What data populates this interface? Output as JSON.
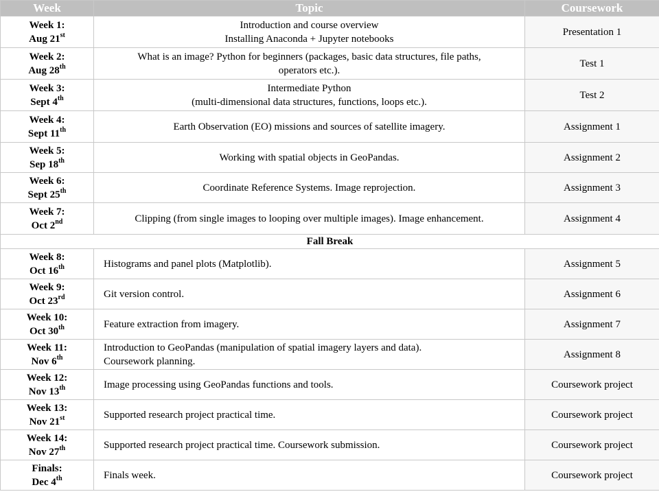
{
  "header": {
    "week": "Week",
    "topic": "Topic",
    "coursework": "Coursework"
  },
  "break_label": "Fall Break",
  "rows_before_break": [
    {
      "week": "Week 1:",
      "date": "Aug 21",
      "suffix": "st",
      "topic": [
        "Introduction and course overview",
        "Installing Anaconda + Jupyter notebooks"
      ],
      "coursework": "Presentation 1",
      "align": "center",
      "h": 46
    },
    {
      "week": "Week 2:",
      "date": "Aug 28",
      "suffix": "th",
      "topic": [
        "What is an image? Python for beginners (packages, basic data structures, file paths,",
        "operators etc.)."
      ],
      "coursework": "Test 1",
      "align": "center",
      "h": 46
    },
    {
      "week": "Week 3:",
      "date": "Sept 4",
      "suffix": "th",
      "topic": [
        "Intermediate Python",
        "(multi-dimensional data structures, functions, loops etc.)."
      ],
      "coursework": "Test 2",
      "align": "center",
      "h": 46
    },
    {
      "week": "Week 4:",
      "date": "Sept 11",
      "suffix": "th",
      "topic": [
        "Earth Observation (EO) missions and sources of satellite imagery."
      ],
      "coursework": "Assignment 1",
      "align": "center",
      "h": 46
    },
    {
      "week": "Week 5:",
      "date": "Sep 18",
      "suffix": "th",
      "topic": [
        "Working with spatial objects in GeoPandas."
      ],
      "coursework": "Assignment 2",
      "align": "center",
      "h": 44
    },
    {
      "week": "Week 6:",
      "date": "Sept 25",
      "suffix": "th",
      "topic": [
        "Coordinate Reference Systems. Image reprojection."
      ],
      "coursework": "Assignment 3",
      "align": "center",
      "h": 44
    },
    {
      "week": "Week 7:",
      "date": "Oct 2",
      "suffix": "nd",
      "topic": [
        "Clipping (from single images to looping over multiple images). Image enhancement."
      ],
      "coursework": "Assignment 4",
      "align": "center",
      "h": 46
    }
  ],
  "rows_after_break": [
    {
      "week": "Week 8:",
      "date": "Oct 16",
      "suffix": "th",
      "topic": [
        "Histograms and panel plots (Matplotlib)."
      ],
      "coursework": "Assignment 5",
      "align": "left",
      "h": 44
    },
    {
      "week": "Week 9:",
      "date": "Oct 23",
      "suffix": "rd",
      "topic": [
        "Git version control."
      ],
      "coursework": "Assignment 6",
      "align": "left",
      "h": 44
    },
    {
      "week": "Week 10:",
      "date": "Oct 30",
      "suffix": "th",
      "topic": [
        "Feature extraction from imagery."
      ],
      "coursework": "Assignment 7",
      "align": "left",
      "h": 44
    },
    {
      "week": "Week 11:",
      "date": "Nov 6",
      "suffix": "th",
      "topic": [
        "Introduction to GeoPandas (manipulation of spatial imagery layers and data).",
        "Coursework planning."
      ],
      "coursework": "Assignment 8",
      "align": "left",
      "h": 44
    },
    {
      "week": "Week 12:",
      "date": "Nov 13",
      "suffix": "th",
      "topic": [
        "Image processing using GeoPandas functions and tools."
      ],
      "coursework": "Coursework project",
      "align": "left",
      "h": 44
    },
    {
      "week": "Week 13:",
      "date": "Nov 21",
      "suffix": "st",
      "topic": [
        "Supported research project practical time."
      ],
      "coursework": "Coursework project",
      "align": "left",
      "h": 44
    },
    {
      "week": "Week 14:",
      "date": "Nov 27",
      "suffix": "th",
      "topic": [
        "Supported research project practical time. Coursework submission."
      ],
      "coursework": "Coursework project",
      "align": "left",
      "h": 44
    },
    {
      "week": "Finals:",
      "date": "Dec 4",
      "suffix": "th",
      "topic": [
        "Finals week."
      ],
      "coursework": "Coursework project",
      "align": "left",
      "h": 44
    }
  ]
}
